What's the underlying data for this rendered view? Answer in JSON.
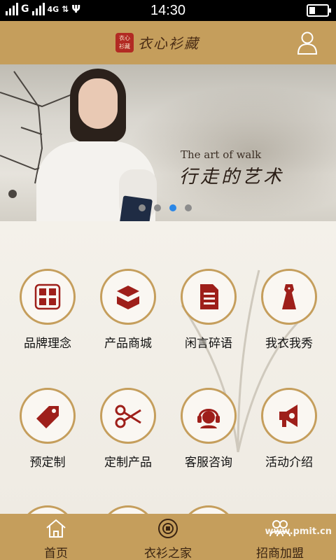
{
  "status_bar": {
    "network_1": "G",
    "network_2": "4G",
    "time": "14:30"
  },
  "header": {
    "brand_seal": "衣心衫藏",
    "brand_name": "衣心衫藏",
    "user_icon": "user-icon"
  },
  "banner": {
    "subtitle_en": "The art of walk",
    "title_zh": "行走的艺术",
    "slide_count": 4,
    "active_slide": 3
  },
  "grid": {
    "items": [
      {
        "label": "品牌理念",
        "icon": "seal-icon"
      },
      {
        "label": "产品商城",
        "icon": "boxes-icon"
      },
      {
        "label": "闲言碎语",
        "icon": "document-icon"
      },
      {
        "label": "我衣我秀",
        "icon": "qipao-icon"
      },
      {
        "label": "预定制",
        "icon": "tag-icon"
      },
      {
        "label": "定制产品",
        "icon": "scissors-icon"
      },
      {
        "label": "客服咨询",
        "icon": "headset-icon"
      },
      {
        "label": "活动介绍",
        "icon": "megaphone-icon"
      }
    ]
  },
  "tabbar": {
    "items": [
      {
        "label": "首页",
        "icon": "home-icon"
      },
      {
        "label": "衣衫之家",
        "icon": "coin-icon"
      },
      {
        "label": "招商加盟",
        "icon": "people-icon"
      }
    ]
  },
  "watermark": "www.pmit.cn",
  "colors": {
    "accent": "#c59e5c",
    "icon_red": "#9e1f1a",
    "active_dot": "#2a86e6"
  }
}
